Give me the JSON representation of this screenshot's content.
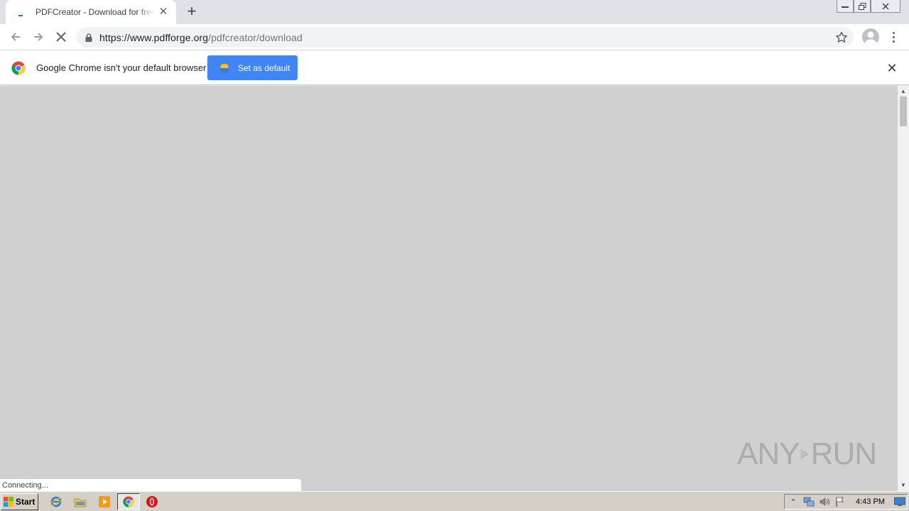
{
  "browser": {
    "tab": {
      "title": "PDFCreator - Download for free, download pdf printer, pdf writer, pdf maker"
    },
    "address": {
      "domain": "https://www.pdfforge.org",
      "path": "/pdfcreator/download"
    }
  },
  "infobar": {
    "message": "Google Chrome isn't your default browser",
    "button_label": "Set as default"
  },
  "page": {
    "status_text": "Connecting..."
  },
  "watermark": {
    "left": "ANY",
    "right": "RUN"
  },
  "taskbar": {
    "start_label": "Start",
    "clock": "4:43 PM"
  }
}
